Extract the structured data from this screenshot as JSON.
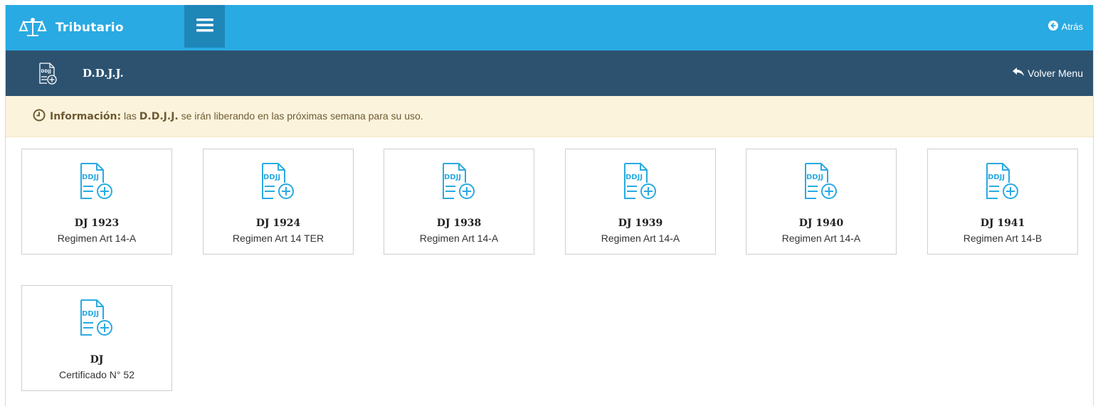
{
  "header": {
    "app_title": "Tributario",
    "back_label": "Atrás"
  },
  "subheader": {
    "title": "D.D.J.J.",
    "return_label": "Volver Menu"
  },
  "info": {
    "label": "Información:",
    "text_before": " las ",
    "highlight": "D.D.J.J.",
    "text_after": " se irán liberando en las próximas semana para su uso."
  },
  "cards": [
    {
      "code": "DJ 1923",
      "description": "Regimen Art 14-A"
    },
    {
      "code": "DJ 1924",
      "description": "Regimen Art 14 TER"
    },
    {
      "code": "DJ 1938",
      "description": "Regimen Art 14-A"
    },
    {
      "code": "DJ 1939",
      "description": "Regimen Art 14-A"
    },
    {
      "code": "DJ 1940",
      "description": "Regimen Art 14-A"
    },
    {
      "code": "DJ 1941",
      "description": "Regimen Art 14-B"
    },
    {
      "code": "DJ",
      "description": "Certificado N° 52"
    }
  ],
  "icons": {
    "brand": "scales-icon",
    "menu": "hamburger-menu-icon",
    "back": "circle-arrow-left-icon",
    "section": "ddjj-document-icon",
    "return": "reply-arrow-icon",
    "info": "clock-icon",
    "card": "ddjj-document-add-icon"
  },
  "icon_doc_text": "DDJJ",
  "colors": {
    "topbar": "#29aae2",
    "menu_button": "#1f86b8",
    "subbar": "#2d5270",
    "info_bg": "#fcf3dc",
    "info_text": "#6d5b34",
    "card_icon": "#29aae2"
  }
}
